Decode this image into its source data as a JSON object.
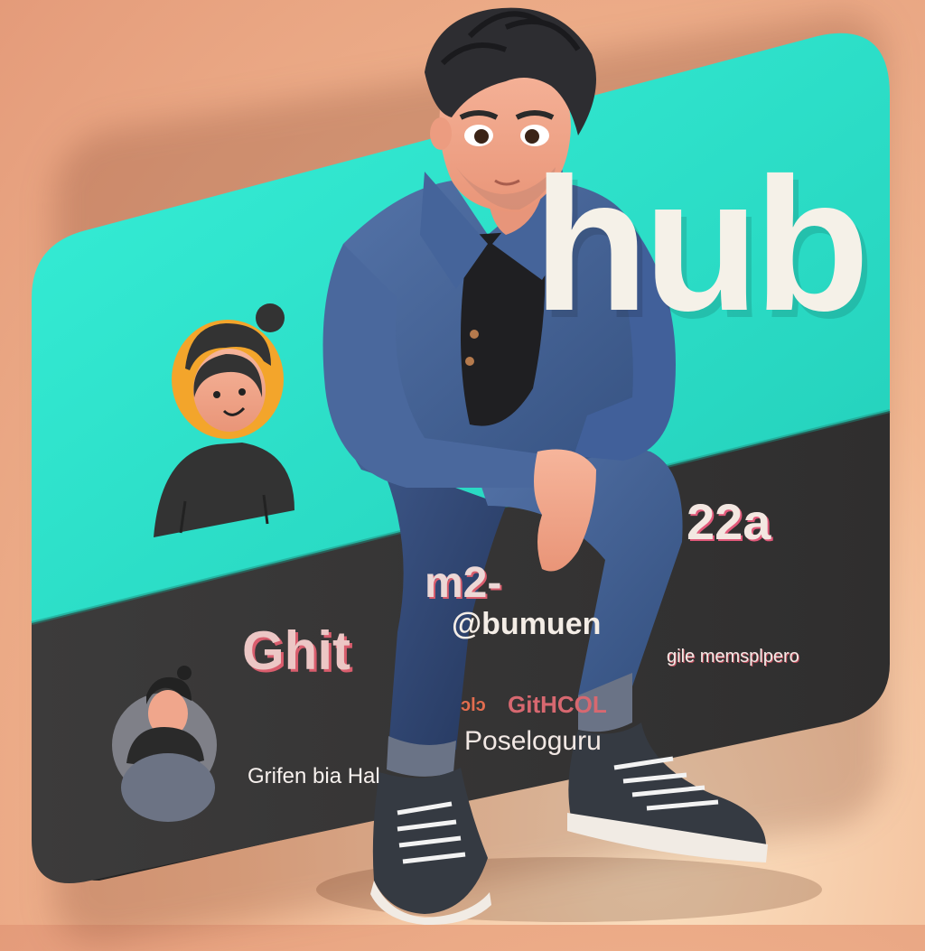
{
  "card": {
    "brand_word": "hub",
    "number_suffix": "22a",
    "title_partial": "Ghit",
    "middle_fragment": "m2-",
    "handle": "@bumuen",
    "right_caption": "gile memsplpero",
    "orange_fragment": "ɔlɔ",
    "pink_fragment": "GitHCOL",
    "sub_caption": "Poseloguru",
    "bottom_caption": "Grifen bia Hal"
  },
  "colors": {
    "card_teal": "#2ee8d0",
    "card_dark": "#3a3939",
    "background": "#f2b892",
    "jacket": "#4b6a9d",
    "accent_avatar": "#f2a12d"
  }
}
